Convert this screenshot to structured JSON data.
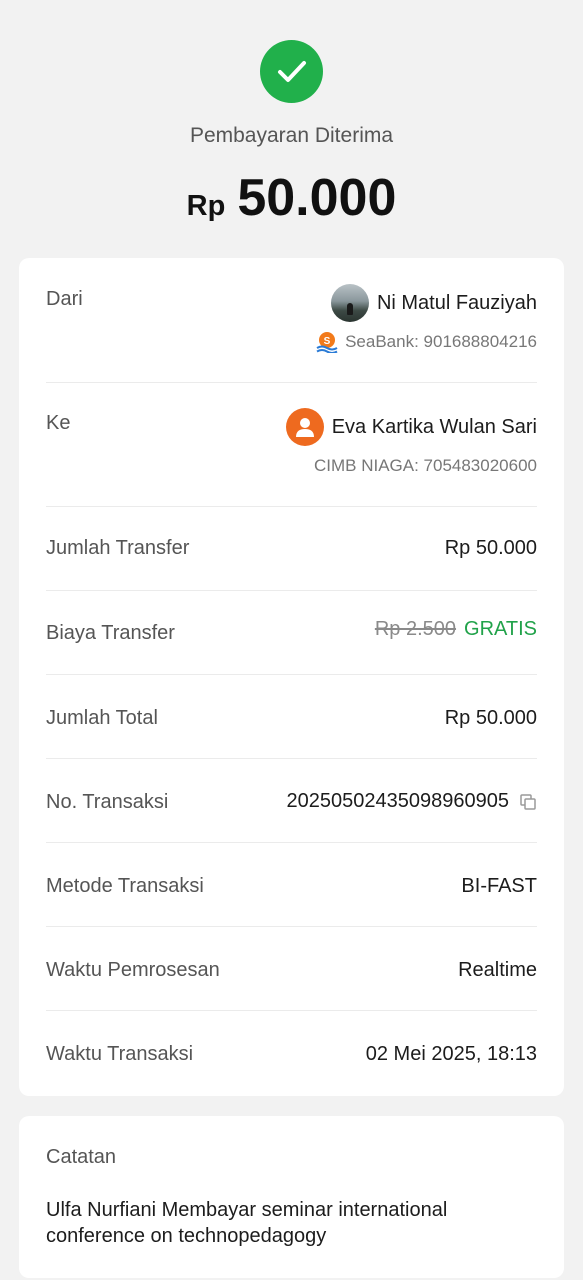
{
  "header": {
    "status_icon": "check-circle-icon",
    "status_title": "Pembayaran Diterima",
    "currency": "Rp",
    "amount": "50.000",
    "accent_color": "#21b04b"
  },
  "details": {
    "from": {
      "label": "Dari",
      "name": "Ni Matul Fauziyah",
      "bank_account": "SeaBank: 901688804216",
      "avatar": "profile-photo",
      "bank_icon": "seabank-logo-icon"
    },
    "to": {
      "label": "Ke",
      "name": "Eva Kartika Wulan Sari",
      "bank_account": "CIMB NIAGA: 705483020600",
      "avatar": "person-icon"
    },
    "rows": [
      {
        "label": "Jumlah Transfer",
        "value": "Rp 50.000"
      },
      {
        "label": "Biaya Transfer",
        "original": "Rp 2.500",
        "value": "GRATIS"
      },
      {
        "label": "Jumlah Total",
        "value": "Rp 50.000"
      },
      {
        "label": "No. Transaksi",
        "value": "20250502435098960905"
      },
      {
        "label": "Metode Transaksi",
        "value": "BI-FAST"
      },
      {
        "label": "Waktu Pemrosesan",
        "value": "Realtime"
      },
      {
        "label": "Waktu Transaksi",
        "value": "02 Mei 2025, 18:13"
      }
    ],
    "free_color": "#21a24a"
  },
  "notes": {
    "label": "Catatan",
    "text": "Ulfa Nurfiani Membayar seminar international conference on technopedagogy"
  }
}
